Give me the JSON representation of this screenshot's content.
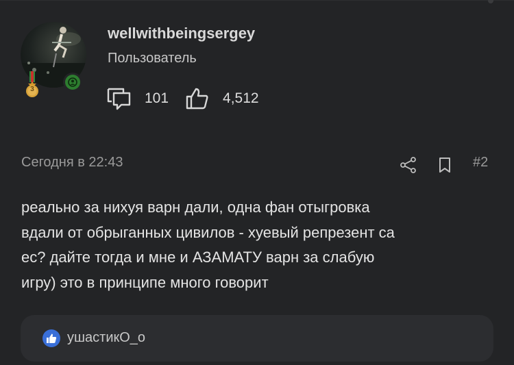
{
  "user": {
    "username": "wellwithbeingsergey",
    "role": "Пользователь",
    "medal_level": "3",
    "stats": {
      "messages": "101",
      "likes": "4,512"
    }
  },
  "post": {
    "date": "Сегодня в 22:43",
    "number": "#2",
    "text": "реально за нихуя варн дали, одна фан отыгровка\nвдали от обрыганных цивилов - хуевый репрезент са\nес? дайте тогда и мне и АЗАМАТУ варн за слабую\nигру) это в принципе много говорит"
  },
  "reactions": {
    "likers": "ушастикО_о"
  },
  "icons": {
    "messages": "messages-icon",
    "likes": "thumbs-up-icon",
    "share": "share-icon",
    "bookmark": "bookmark-icon",
    "online": "online-user-icon",
    "medal": "medal-icon",
    "like_badge": "like-badge-icon"
  },
  "colors": {
    "background": "#232426",
    "online": "#2d7d2f",
    "like_badge": "#3a6fd8",
    "likes_box": "#2c2d30"
  }
}
